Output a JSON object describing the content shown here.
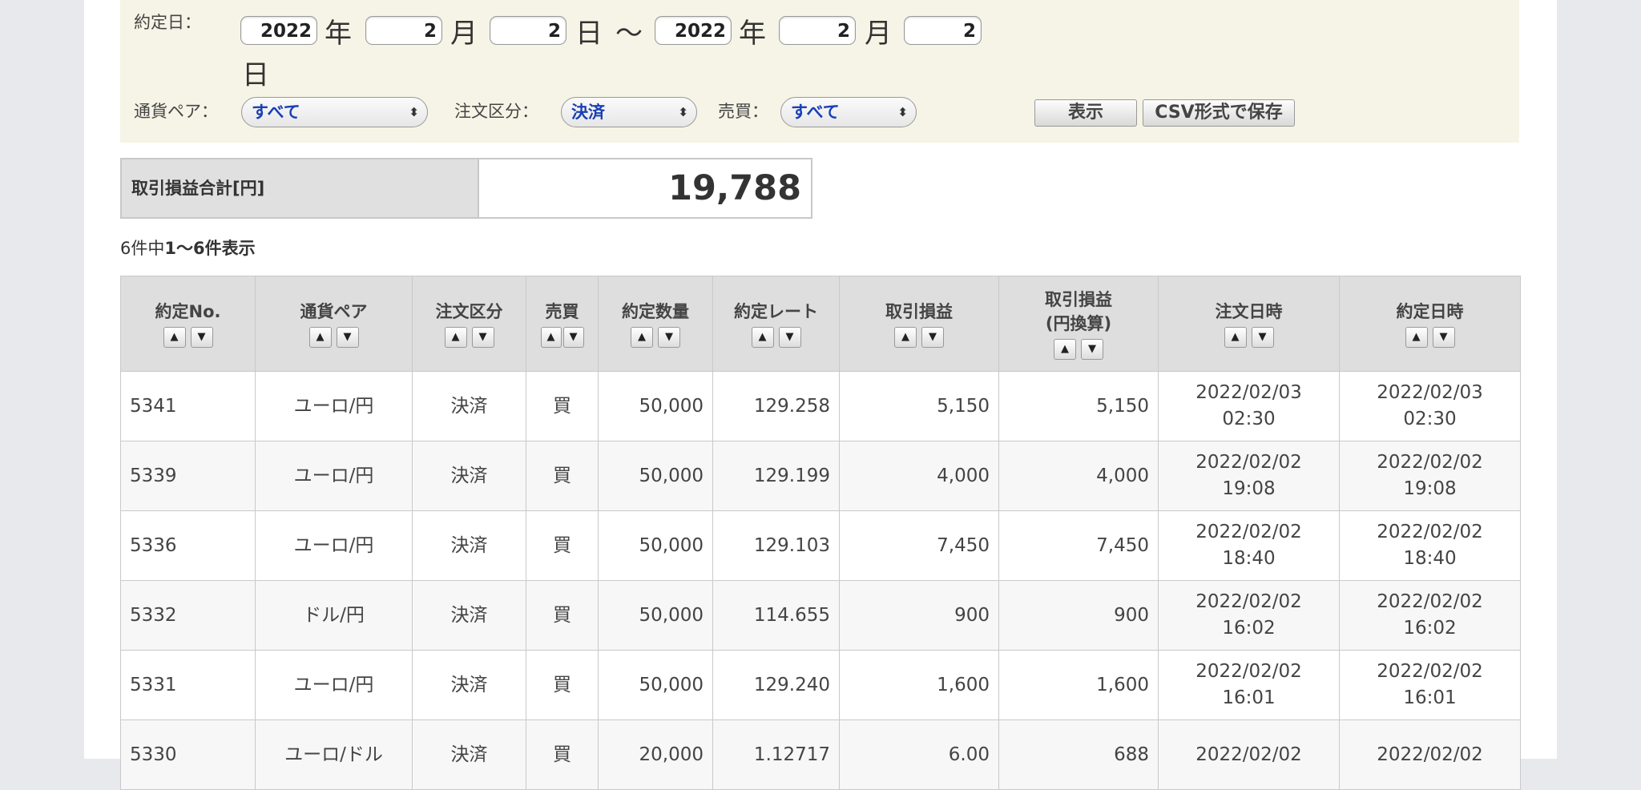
{
  "filter": {
    "date_label": "約定日：",
    "from_year": "2022",
    "from_month": "2",
    "from_day": "2",
    "to_year": "2022",
    "to_month": "2",
    "to_day": "2",
    "unit_year": "年",
    "unit_month": "月",
    "unit_day": "日",
    "tilde": "〜",
    "pair_label": "通貨ペア：",
    "pair_value": "すべて",
    "order_type_label": "注文区分：",
    "order_type_value": "決済",
    "side_label": "売買：",
    "side_value": "すべて",
    "show_button": "表示",
    "csv_button": "CSV形式で保存"
  },
  "summary": {
    "label": "取引損益合計[円]",
    "value": "19,788"
  },
  "count": {
    "prefix": "6件中",
    "range": "1〜6件表示"
  },
  "table": {
    "headers": {
      "no": "約定No.",
      "pair": "通貨ペア",
      "order_type": "注文区分",
      "side": "売買",
      "qty": "約定数量",
      "rate": "約定レート",
      "pl": "取引損益",
      "pl_jpy_1": "取引損益",
      "pl_jpy_2": "(円換算)",
      "order_time": "注文日時",
      "exec_time": "約定日時"
    },
    "rows": [
      {
        "no": "5341",
        "pair": "ユーロ/円",
        "type": "決済",
        "side": "買",
        "qty": "50,000",
        "rate": "129.258",
        "pl": "5,150",
        "pl_jpy": "5,150",
        "order_date": "2022/02/03",
        "order_time": "02:30",
        "exec_date": "2022/02/03",
        "exec_time": "02:30"
      },
      {
        "no": "5339",
        "pair": "ユーロ/円",
        "type": "決済",
        "side": "買",
        "qty": "50,000",
        "rate": "129.199",
        "pl": "4,000",
        "pl_jpy": "4,000",
        "order_date": "2022/02/02",
        "order_time": "19:08",
        "exec_date": "2022/02/02",
        "exec_time": "19:08"
      },
      {
        "no": "5336",
        "pair": "ユーロ/円",
        "type": "決済",
        "side": "買",
        "qty": "50,000",
        "rate": "129.103",
        "pl": "7,450",
        "pl_jpy": "7,450",
        "order_date": "2022/02/02",
        "order_time": "18:40",
        "exec_date": "2022/02/02",
        "exec_time": "18:40"
      },
      {
        "no": "5332",
        "pair": "ドル/円",
        "type": "決済",
        "side": "買",
        "qty": "50,000",
        "rate": "114.655",
        "pl": "900",
        "pl_jpy": "900",
        "order_date": "2022/02/02",
        "order_time": "16:02",
        "exec_date": "2022/02/02",
        "exec_time": "16:02"
      },
      {
        "no": "5331",
        "pair": "ユーロ/円",
        "type": "決済",
        "side": "買",
        "qty": "50,000",
        "rate": "129.240",
        "pl": "1,600",
        "pl_jpy": "1,600",
        "order_date": "2022/02/02",
        "order_time": "16:01",
        "exec_date": "2022/02/02",
        "exec_time": "16:01"
      },
      {
        "no": "5330",
        "pair": "ユーロ/ドル",
        "type": "決済",
        "side": "買",
        "qty": "20,000",
        "rate": "1.12717",
        "pl": "6.00",
        "pl_jpy": "688",
        "order_date": "2022/02/02",
        "order_time": "",
        "exec_date": "2022/02/02",
        "exec_time": ""
      }
    ]
  },
  "icons": {
    "sort_up": "▲",
    "sort_down": "▼",
    "select_chevron": "⌃⌄"
  },
  "colors": {
    "filter_bg": "#f6f4e6",
    "select_text": "#1a3fb5",
    "buy_red": "#c0392b"
  }
}
